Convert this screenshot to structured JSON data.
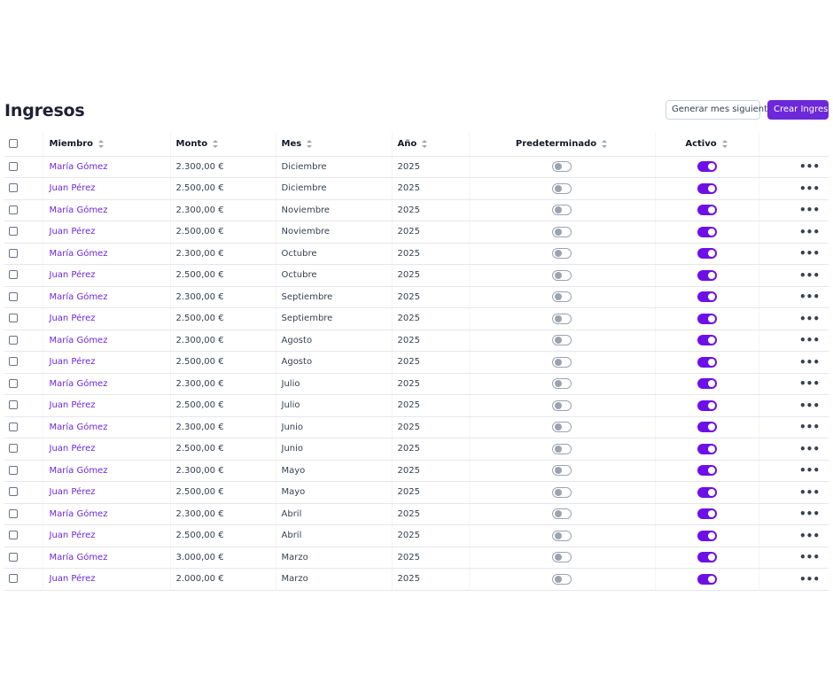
{
  "page": {
    "title": "Ingresos",
    "generate_button": "Generar mes siguiente",
    "create_button": "Crear Ingreso"
  },
  "table": {
    "columns": {
      "member": "Miembro",
      "amount": "Monto",
      "month": "Mes",
      "year": "Año",
      "default": "Predeterminado",
      "active": "Activo"
    },
    "rows": [
      {
        "member": "María Gómez",
        "amount": "2.300,00 €",
        "month": "Diciembre",
        "year": "2025",
        "default": false,
        "active": true
      },
      {
        "member": "Juan Pérez",
        "amount": "2.500,00 €",
        "month": "Diciembre",
        "year": "2025",
        "default": false,
        "active": true
      },
      {
        "member": "María Gómez",
        "amount": "2.300,00 €",
        "month": "Noviembre",
        "year": "2025",
        "default": false,
        "active": true
      },
      {
        "member": "Juan Pérez",
        "amount": "2.500,00 €",
        "month": "Noviembre",
        "year": "2025",
        "default": false,
        "active": true
      },
      {
        "member": "María Gómez",
        "amount": "2.300,00 €",
        "month": "Octubre",
        "year": "2025",
        "default": false,
        "active": true
      },
      {
        "member": "Juan Pérez",
        "amount": "2.500,00 €",
        "month": "Octubre",
        "year": "2025",
        "default": false,
        "active": true
      },
      {
        "member": "María Gómez",
        "amount": "2.300,00 €",
        "month": "Septiembre",
        "year": "2025",
        "default": false,
        "active": true
      },
      {
        "member": "Juan Pérez",
        "amount": "2.500,00 €",
        "month": "Septiembre",
        "year": "2025",
        "default": false,
        "active": true
      },
      {
        "member": "María Gómez",
        "amount": "2.300,00 €",
        "month": "Agosto",
        "year": "2025",
        "default": false,
        "active": true
      },
      {
        "member": "Juan Pérez",
        "amount": "2.500,00 €",
        "month": "Agosto",
        "year": "2025",
        "default": false,
        "active": true
      },
      {
        "member": "María Gómez",
        "amount": "2.300,00 €",
        "month": "Julio",
        "year": "2025",
        "default": false,
        "active": true
      },
      {
        "member": "Juan Pérez",
        "amount": "2.500,00 €",
        "month": "Julio",
        "year": "2025",
        "default": false,
        "active": true
      },
      {
        "member": "María Gómez",
        "amount": "2.300,00 €",
        "month": "Junio",
        "year": "2025",
        "default": false,
        "active": true
      },
      {
        "member": "Juan Pérez",
        "amount": "2.500,00 €",
        "month": "Junio",
        "year": "2025",
        "default": false,
        "active": true
      },
      {
        "member": "María Gómez",
        "amount": "2.300,00 €",
        "month": "Mayo",
        "year": "2025",
        "default": false,
        "active": true
      },
      {
        "member": "Juan Pérez",
        "amount": "2.500,00 €",
        "month": "Mayo",
        "year": "2025",
        "default": false,
        "active": true
      },
      {
        "member": "María Gómez",
        "amount": "2.300,00 €",
        "month": "Abril",
        "year": "2025",
        "default": false,
        "active": true
      },
      {
        "member": "Juan Pérez",
        "amount": "2.500,00 €",
        "month": "Abril",
        "year": "2025",
        "default": false,
        "active": true
      },
      {
        "member": "María Gómez",
        "amount": "3.000,00 €",
        "month": "Marzo",
        "year": "2025",
        "default": false,
        "active": true
      },
      {
        "member": "Juan Pérez",
        "amount": "2.000,00 €",
        "month": "Marzo",
        "year": "2025",
        "default": false,
        "active": true
      }
    ],
    "row_menu_icon": "ellipsis-icon",
    "sort_icon": "sort-icon"
  },
  "colors": {
    "accent": "#6d28d9",
    "toggle_on": "#6d10e8",
    "toggle_off": "#9ca3af",
    "title": "#1e2033"
  }
}
